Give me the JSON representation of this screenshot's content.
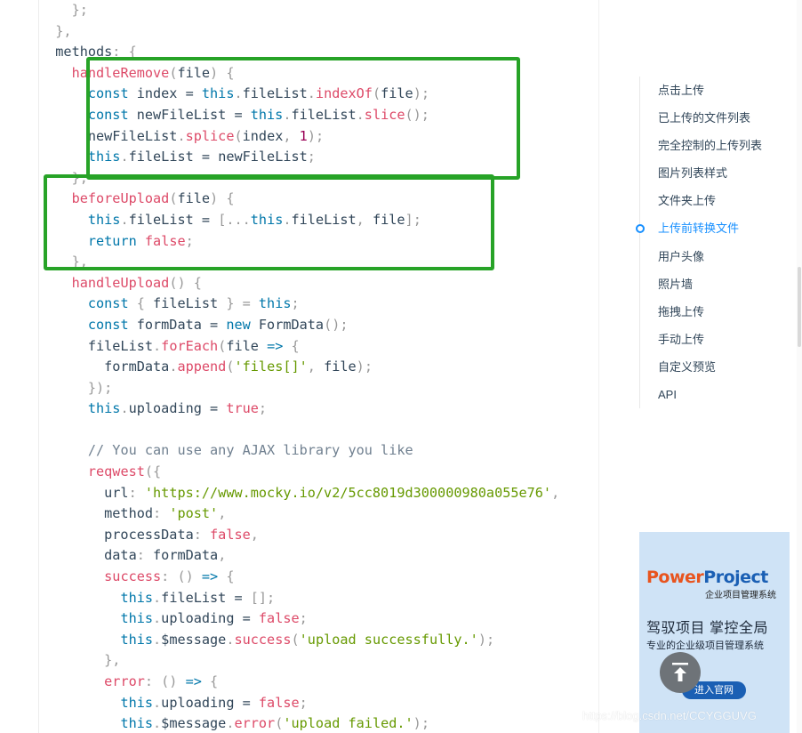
{
  "code_lines": [
    [
      [
        "p",
        "    };"
      ]
    ],
    [
      [
        "p",
        "  },"
      ]
    ],
    [
      [
        "t",
        "  methods"
      ],
      [
        "p",
        ": {"
      ]
    ],
    [
      [
        "t",
        "    "
      ],
      [
        "f",
        "handleRemove"
      ],
      [
        "p",
        "("
      ],
      [
        "t",
        "file"
      ],
      [
        "p",
        ") {"
      ]
    ],
    [
      [
        "t",
        "      "
      ],
      [
        "k",
        "const"
      ],
      [
        "t",
        " index = "
      ],
      [
        "k",
        "this"
      ],
      [
        "p",
        "."
      ],
      [
        "t",
        "fileList"
      ],
      [
        "p",
        "."
      ],
      [
        "f",
        "indexOf"
      ],
      [
        "p",
        "("
      ],
      [
        "t",
        "file"
      ],
      [
        "p",
        ");"
      ]
    ],
    [
      [
        "t",
        "      "
      ],
      [
        "k",
        "const"
      ],
      [
        "t",
        " newFileList = "
      ],
      [
        "k",
        "this"
      ],
      [
        "p",
        "."
      ],
      [
        "t",
        "fileList"
      ],
      [
        "p",
        "."
      ],
      [
        "f",
        "slice"
      ],
      [
        "p",
        "();"
      ]
    ],
    [
      [
        "t",
        "      newFileList"
      ],
      [
        "p",
        "."
      ],
      [
        "f",
        "splice"
      ],
      [
        "p",
        "("
      ],
      [
        "t",
        "index"
      ],
      [
        "p",
        ", "
      ],
      [
        "n",
        "1"
      ],
      [
        "p",
        ");"
      ]
    ],
    [
      [
        "t",
        "      "
      ],
      [
        "k",
        "this"
      ],
      [
        "p",
        "."
      ],
      [
        "t",
        "fileList = newFileList"
      ],
      [
        "p",
        ";"
      ]
    ],
    [
      [
        "p",
        "    },"
      ]
    ],
    [
      [
        "t",
        "    "
      ],
      [
        "f",
        "beforeUpload"
      ],
      [
        "p",
        "("
      ],
      [
        "t",
        "file"
      ],
      [
        "p",
        ") {"
      ]
    ],
    [
      [
        "t",
        "      "
      ],
      [
        "k",
        "this"
      ],
      [
        "p",
        "."
      ],
      [
        "t",
        "fileList = "
      ],
      [
        "p",
        "[..."
      ],
      [
        "k",
        "this"
      ],
      [
        "p",
        "."
      ],
      [
        "t",
        "fileList"
      ],
      [
        "p",
        ", "
      ],
      [
        "t",
        "file"
      ],
      [
        "p",
        "];"
      ]
    ],
    [
      [
        "t",
        "      "
      ],
      [
        "k",
        "return"
      ],
      [
        "t",
        " "
      ],
      [
        "f",
        "false"
      ],
      [
        "p",
        ";"
      ]
    ],
    [
      [
        "p",
        "    },"
      ]
    ],
    [
      [
        "t",
        "    "
      ],
      [
        "f",
        "handleUpload"
      ],
      [
        "p",
        "() {"
      ]
    ],
    [
      [
        "t",
        "      "
      ],
      [
        "k",
        "const"
      ],
      [
        "p",
        " { "
      ],
      [
        "t",
        "fileList"
      ],
      [
        "p",
        " } = "
      ],
      [
        "k",
        "this"
      ],
      [
        "p",
        ";"
      ]
    ],
    [
      [
        "t",
        "      "
      ],
      [
        "k",
        "const"
      ],
      [
        "t",
        " formData = "
      ],
      [
        "k",
        "new"
      ],
      [
        "t",
        " FormData"
      ],
      [
        "p",
        "();"
      ]
    ],
    [
      [
        "t",
        "      fileList"
      ],
      [
        "p",
        "."
      ],
      [
        "f",
        "forEach"
      ],
      [
        "p",
        "("
      ],
      [
        "t",
        "file "
      ],
      [
        "k",
        "=>"
      ],
      [
        "p",
        " {"
      ]
    ],
    [
      [
        "t",
        "        formData"
      ],
      [
        "p",
        "."
      ],
      [
        "f",
        "append"
      ],
      [
        "p",
        "("
      ],
      [
        "s",
        "'files[]'"
      ],
      [
        "p",
        ", "
      ],
      [
        "t",
        "file"
      ],
      [
        "p",
        ");"
      ]
    ],
    [
      [
        "p",
        "      });"
      ]
    ],
    [
      [
        "t",
        "      "
      ],
      [
        "k",
        "this"
      ],
      [
        "p",
        "."
      ],
      [
        "t",
        "uploading = "
      ],
      [
        "f",
        "true"
      ],
      [
        "p",
        ";"
      ]
    ],
    [
      [
        "t",
        ""
      ]
    ],
    [
      [
        "t",
        "      "
      ],
      [
        "c",
        "// You can use any AJAX library you like"
      ]
    ],
    [
      [
        "t",
        "      "
      ],
      [
        "f",
        "reqwest"
      ],
      [
        "p",
        "({"
      ]
    ],
    [
      [
        "t",
        "        url"
      ],
      [
        "p",
        ": "
      ],
      [
        "s",
        "'https://www.mocky.io/v2/5cc8019d300000980a055e76'"
      ],
      [
        "p",
        ","
      ]
    ],
    [
      [
        "t",
        "        method"
      ],
      [
        "p",
        ": "
      ],
      [
        "s",
        "'post'"
      ],
      [
        "p",
        ","
      ]
    ],
    [
      [
        "t",
        "        processData"
      ],
      [
        "p",
        ": "
      ],
      [
        "f",
        "false"
      ],
      [
        "p",
        ","
      ]
    ],
    [
      [
        "t",
        "        data"
      ],
      [
        "p",
        ": "
      ],
      [
        "t",
        "formData"
      ],
      [
        "p",
        ","
      ]
    ],
    [
      [
        "t",
        "        "
      ],
      [
        "f",
        "success"
      ],
      [
        "p",
        ": () "
      ],
      [
        "k",
        "=>"
      ],
      [
        "p",
        " {"
      ]
    ],
    [
      [
        "t",
        "          "
      ],
      [
        "k",
        "this"
      ],
      [
        "p",
        "."
      ],
      [
        "t",
        "fileList = "
      ],
      [
        "p",
        "[];"
      ]
    ],
    [
      [
        "t",
        "          "
      ],
      [
        "k",
        "this"
      ],
      [
        "p",
        "."
      ],
      [
        "t",
        "uploading = "
      ],
      [
        "f",
        "false"
      ],
      [
        "p",
        ";"
      ]
    ],
    [
      [
        "t",
        "          "
      ],
      [
        "k",
        "this"
      ],
      [
        "p",
        "."
      ],
      [
        "t",
        "$message"
      ],
      [
        "p",
        "."
      ],
      [
        "f",
        "success"
      ],
      [
        "p",
        "("
      ],
      [
        "s",
        "'upload successfully.'"
      ],
      [
        "p",
        ");"
      ]
    ],
    [
      [
        "p",
        "        },"
      ]
    ],
    [
      [
        "t",
        "        "
      ],
      [
        "f",
        "error"
      ],
      [
        "p",
        ": () "
      ],
      [
        "k",
        "=>"
      ],
      [
        "p",
        " {"
      ]
    ],
    [
      [
        "t",
        "          "
      ],
      [
        "k",
        "this"
      ],
      [
        "p",
        "."
      ],
      [
        "t",
        "uploading = "
      ],
      [
        "f",
        "false"
      ],
      [
        "p",
        ";"
      ]
    ],
    [
      [
        "t",
        "          "
      ],
      [
        "k",
        "this"
      ],
      [
        "p",
        "."
      ],
      [
        "t",
        "$message"
      ],
      [
        "p",
        "."
      ],
      [
        "f",
        "error"
      ],
      [
        "p",
        "("
      ],
      [
        "s",
        "'upload failed.'"
      ],
      [
        "p",
        ");"
      ]
    ]
  ],
  "highlight_color": "#27a327",
  "toc": {
    "items": [
      {
        "label": "点击上传",
        "active": false
      },
      {
        "label": "已上传的文件列表",
        "active": false
      },
      {
        "label": "完全控制的上传列表",
        "active": false
      },
      {
        "label": "图片列表样式",
        "active": false
      },
      {
        "label": "文件夹上传",
        "active": false
      },
      {
        "label": "上传前转换文件",
        "active": true
      },
      {
        "label": "用户头像",
        "active": false
      },
      {
        "label": "照片墙",
        "active": false
      },
      {
        "label": "拖拽上传",
        "active": false
      },
      {
        "label": "手动上传",
        "active": false
      },
      {
        "label": "自定义预览",
        "active": false
      },
      {
        "label": "API",
        "active": false
      }
    ]
  },
  "ad": {
    "logo_power": "Power",
    "logo_project": "Project",
    "subtitle": "企业项目管理系统",
    "slogan": "驾驭项目 掌控全局",
    "description": "专业的企业级项目管理系统",
    "button": "进入官网"
  },
  "watermark": "https://blog.csdn.net/CCYGGUVG"
}
